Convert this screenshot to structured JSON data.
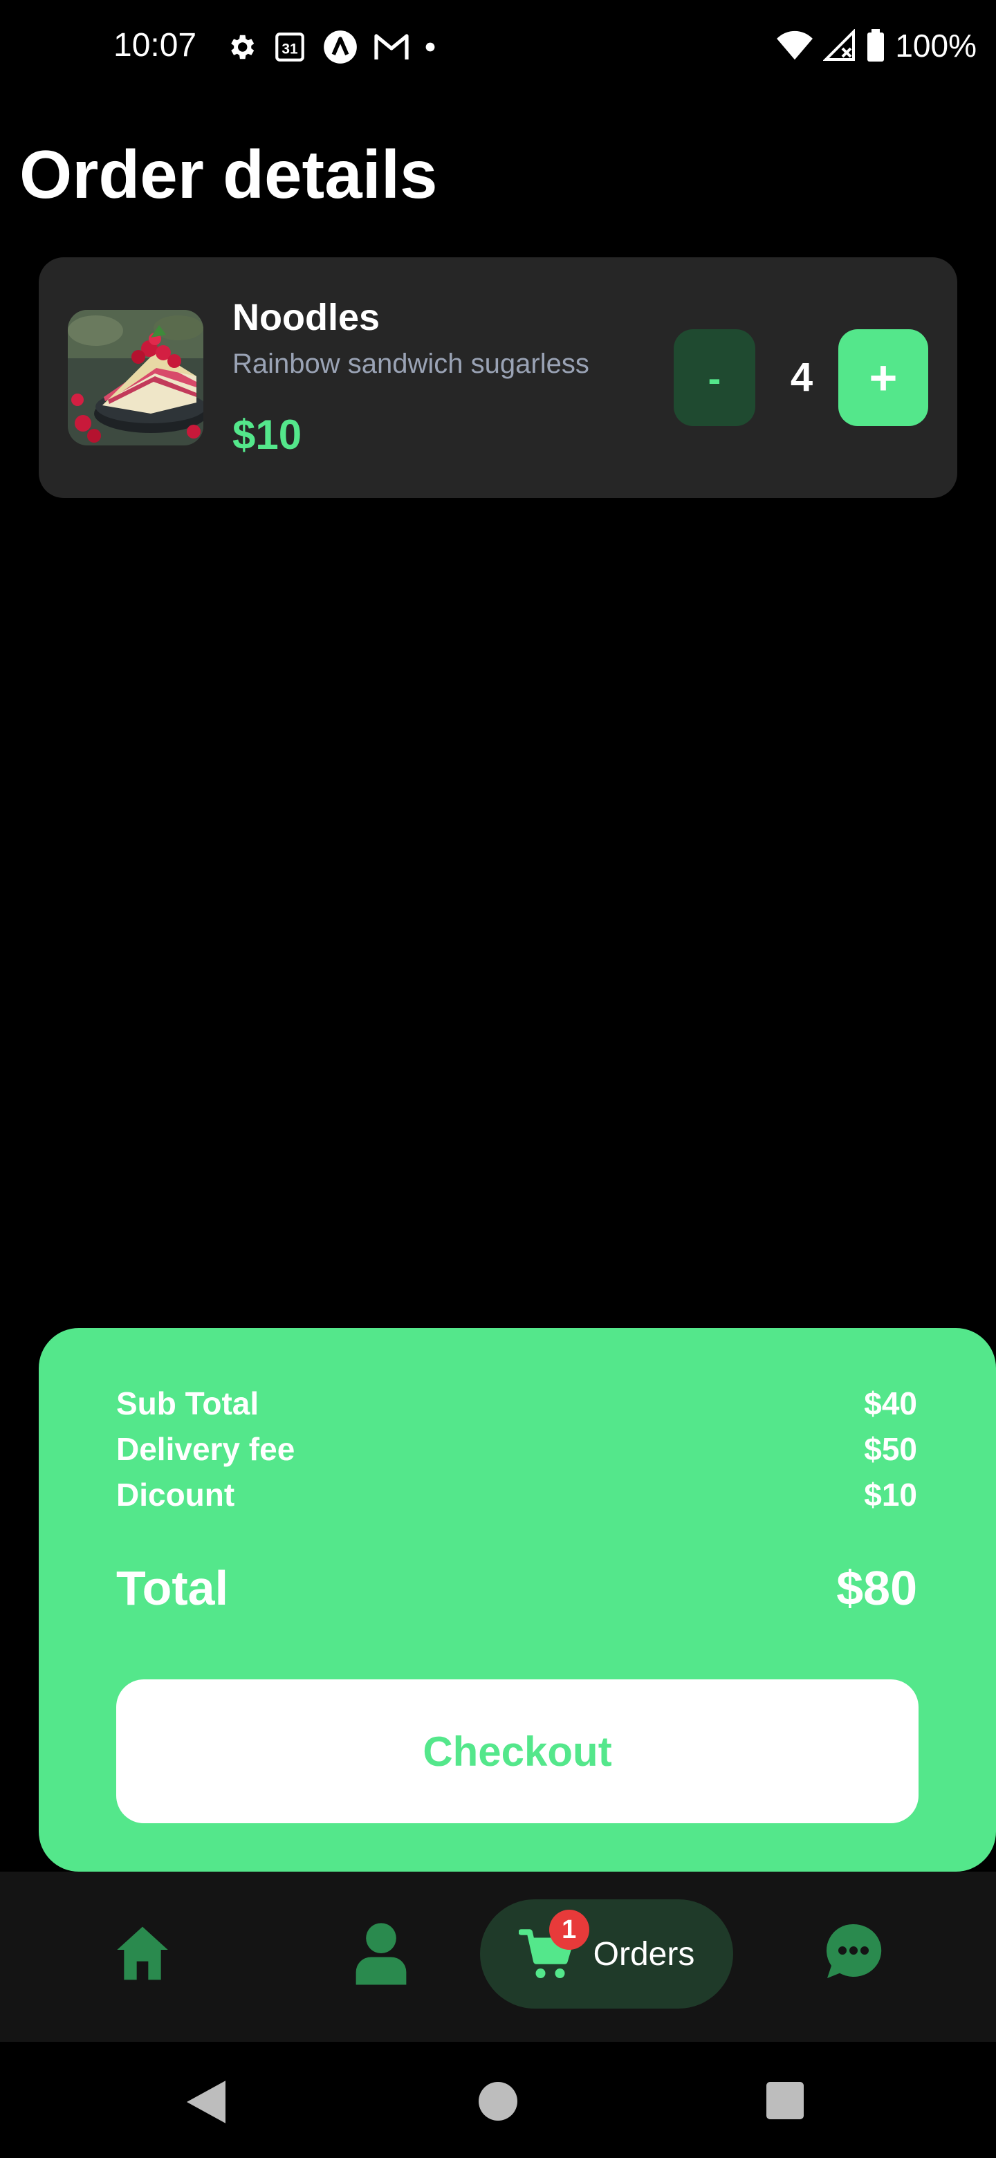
{
  "status_bar": {
    "time": "10:07",
    "battery": "100%",
    "calendar_day": "31",
    "icons_left": [
      "gear-icon",
      "calendar-icon",
      "a-circle-icon",
      "gmail-icon",
      "dot-icon"
    ],
    "icons_right": [
      "wifi-icon",
      "signal-icon",
      "battery-icon"
    ]
  },
  "page": {
    "title": "Order details"
  },
  "order_item": {
    "name": "Noodles",
    "description": "Rainbow sandwich sugarless",
    "price": "$10",
    "quantity": "4",
    "minus_label": "-",
    "plus_label": "+",
    "image": "cake-slice-with-raspberries"
  },
  "summary": {
    "rows": [
      {
        "label": "Sub Total",
        "value": "$40"
      },
      {
        "label": "Delivery fee",
        "value": "$50"
      },
      {
        "label": "Dicount",
        "value": "$10"
      }
    ],
    "total_label": "Total",
    "total_value": "$80",
    "checkout_label": "Checkout"
  },
  "bottom_nav": {
    "items": [
      {
        "name": "home",
        "icon": "home-icon"
      },
      {
        "name": "profile",
        "icon": "person-icon"
      },
      {
        "name": "orders",
        "icon": "cart-icon",
        "label": "Orders",
        "badge": "1",
        "active": true
      },
      {
        "name": "chat",
        "icon": "chat-icon"
      }
    ]
  },
  "colors": {
    "accent": "#54e78b",
    "card_bg": "#262626",
    "nav_bg": "#141414",
    "nav_icon": "#2a8a4e",
    "badge": "#e83a3a"
  }
}
